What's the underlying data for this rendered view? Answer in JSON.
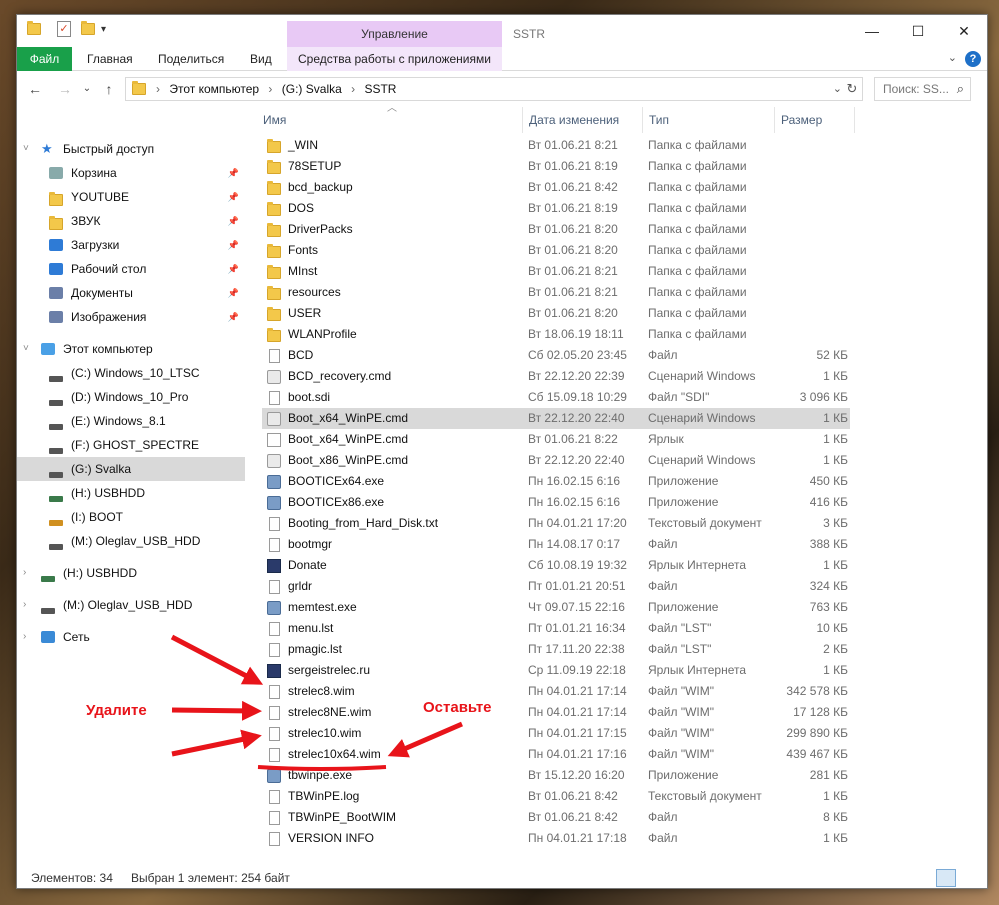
{
  "titlebar": {
    "manage_tab": "Управление",
    "window_title": "SSTR",
    "minimize": "—",
    "maximize": "☐",
    "close": "✕"
  },
  "ribbon": {
    "tabs": [
      "Файл",
      "Главная",
      "Поделиться",
      "Вид",
      "Средства работы с приложениями"
    ],
    "collapse": "⌄",
    "help": "?"
  },
  "address": {
    "back": "←",
    "forward": "→",
    "recent": "⌄",
    "up": "↑",
    "breadcrumbs": [
      "Этот компьютер",
      "(G:) Svalka",
      "SSTR"
    ],
    "refresh": "↻",
    "search_placeholder": "Поиск: SS..."
  },
  "nav": {
    "items": [
      {
        "label": "Быстрый доступ",
        "icon": "star-icon",
        "indent": 0,
        "expanded": true
      },
      {
        "label": "Корзина",
        "icon": "recycle-bin-icon",
        "indent": 1,
        "pinned": true
      },
      {
        "label": "YOUTUBE",
        "icon": "folder-icon",
        "indent": 1,
        "pinned": true
      },
      {
        "label": "ЗВУК",
        "icon": "folder-icon",
        "indent": 1,
        "pinned": true
      },
      {
        "label": "Загрузки",
        "icon": "download-icon",
        "indent": 1,
        "pinned": true
      },
      {
        "label": "Рабочий стол",
        "icon": "desktop-icon",
        "indent": 1,
        "pinned": true
      },
      {
        "label": "Документы",
        "icon": "documents-icon",
        "indent": 1,
        "pinned": true
      },
      {
        "label": "Изображения",
        "icon": "pictures-icon",
        "indent": 1,
        "pinned": true
      },
      {
        "label": "Этот компьютер",
        "icon": "computer-icon",
        "indent": 0,
        "expanded": true
      },
      {
        "label": "(C:) Windows_10_LTSC",
        "icon": "drive-icon",
        "indent": 1
      },
      {
        "label": "(D:) Windows_10_Pro",
        "icon": "drive-icon",
        "indent": 1
      },
      {
        "label": "(E:) Windows_8.1",
        "icon": "drive-icon",
        "indent": 1
      },
      {
        "label": "(F:) GHOST_SPECTRE",
        "icon": "drive-icon",
        "indent": 1
      },
      {
        "label": "(G:) Svalka",
        "icon": "drive-icon",
        "indent": 1,
        "selected": true
      },
      {
        "label": "(H:) USBHDD",
        "icon": "usb-drive-icon",
        "indent": 1
      },
      {
        "label": "(I:) BOOT",
        "icon": "boot-drive-icon",
        "indent": 1
      },
      {
        "label": "(M:) Oleglav_USB_HDD",
        "icon": "drive-icon",
        "indent": 1
      },
      {
        "label": "(H:) USBHDD",
        "icon": "usb-drive-icon",
        "indent": 0
      },
      {
        "label": "(M:) Oleglav_USB_HDD",
        "icon": "drive-icon",
        "indent": 0
      },
      {
        "label": "Сеть",
        "icon": "network-icon",
        "indent": 0
      }
    ]
  },
  "columns": {
    "name": "Имя",
    "date": "Дата изменения",
    "type": "Тип",
    "size": "Размер"
  },
  "files": [
    {
      "name": "_WIN",
      "date": "Вт 01.06.21 8:21",
      "type": "Папка с файлами",
      "size": "",
      "kind": "folder"
    },
    {
      "name": "78SETUP",
      "date": "Вт 01.06.21 8:19",
      "type": "Папка с файлами",
      "size": "",
      "kind": "folder"
    },
    {
      "name": "bcd_backup",
      "date": "Вт 01.06.21 8:42",
      "type": "Папка с файлами",
      "size": "",
      "kind": "folder"
    },
    {
      "name": "DOS",
      "date": "Вт 01.06.21 8:19",
      "type": "Папка с файлами",
      "size": "",
      "kind": "folder"
    },
    {
      "name": "DriverPacks",
      "date": "Вт 01.06.21 8:20",
      "type": "Папка с файлами",
      "size": "",
      "kind": "folder"
    },
    {
      "name": "Fonts",
      "date": "Вт 01.06.21 8:20",
      "type": "Папка с файлами",
      "size": "",
      "kind": "folder"
    },
    {
      "name": "MInst",
      "date": "Вт 01.06.21 8:21",
      "type": "Папка с файлами",
      "size": "",
      "kind": "folder"
    },
    {
      "name": "resources",
      "date": "Вт 01.06.21 8:21",
      "type": "Папка с файлами",
      "size": "",
      "kind": "folder"
    },
    {
      "name": "USER",
      "date": "Вт 01.06.21 8:20",
      "type": "Папка с файлами",
      "size": "",
      "kind": "folder"
    },
    {
      "name": "WLANProfile",
      "date": "Вт 18.06.19 18:11",
      "type": "Папка с файлами",
      "size": "",
      "kind": "folder"
    },
    {
      "name": "BCD",
      "date": "Сб 02.05.20 23:45",
      "type": "Файл",
      "size": "52 КБ",
      "kind": "file"
    },
    {
      "name": "BCD_recovery.cmd",
      "date": "Вт 22.12.20 22:39",
      "type": "Сценарий Windows",
      "size": "1 КБ",
      "kind": "cmd"
    },
    {
      "name": "boot.sdi",
      "date": "Сб 15.09.18 10:29",
      "type": "Файл \"SDI\"",
      "size": "3 096 КБ",
      "kind": "file"
    },
    {
      "name": "Boot_x64_WinPE.cmd",
      "date": "Вт 22.12.20 22:40",
      "type": "Сценарий Windows",
      "size": "1 КБ",
      "kind": "cmd",
      "selected": true
    },
    {
      "name": "Boot_x64_WinPE.cmd",
      "date": "Вт 01.06.21 8:22",
      "type": "Ярлык",
      "size": "1 КБ",
      "kind": "lnk"
    },
    {
      "name": "Boot_x86_WinPE.cmd",
      "date": "Вт 22.12.20 22:40",
      "type": "Сценарий Windows",
      "size": "1 КБ",
      "kind": "cmd"
    },
    {
      "name": "BOOTICEx64.exe",
      "date": "Пн 16.02.15 6:16",
      "type": "Приложение",
      "size": "450 КБ",
      "kind": "exe"
    },
    {
      "name": "BOOTICEx86.exe",
      "date": "Пн 16.02.15 6:16",
      "type": "Приложение",
      "size": "416 КБ",
      "kind": "exe"
    },
    {
      "name": "Booting_from_Hard_Disk.txt",
      "date": "Пн 04.01.21 17:20",
      "type": "Текстовый документ",
      "size": "3 КБ",
      "kind": "file"
    },
    {
      "name": "bootmgr",
      "date": "Пн 14.08.17 0:17",
      "type": "Файл",
      "size": "388 КБ",
      "kind": "file"
    },
    {
      "name": "Donate",
      "date": "Сб 10.08.19 19:32",
      "type": "Ярлык Интернета",
      "size": "1 КБ",
      "kind": "url"
    },
    {
      "name": "grldr",
      "date": "Пт 01.01.21 20:51",
      "type": "Файл",
      "size": "324 КБ",
      "kind": "file"
    },
    {
      "name": "memtest.exe",
      "date": "Чт 09.07.15 22:16",
      "type": "Приложение",
      "size": "763 КБ",
      "kind": "exe"
    },
    {
      "name": "menu.lst",
      "date": "Пт 01.01.21 16:34",
      "type": "Файл \"LST\"",
      "size": "10 КБ",
      "kind": "file"
    },
    {
      "name": "pmagic.lst",
      "date": "Пт 17.11.20 22:38",
      "type": "Файл \"LST\"",
      "size": "2 КБ",
      "kind": "file"
    },
    {
      "name": "sergeistrelec.ru",
      "date": "Ср 11.09.19 22:18",
      "type": "Ярлык Интернета",
      "size": "1 КБ",
      "kind": "url"
    },
    {
      "name": "strelec8.wim",
      "date": "Пн 04.01.21 17:14",
      "type": "Файл \"WIM\"",
      "size": "342 578 КБ",
      "kind": "file"
    },
    {
      "name": "strelec8NE.wim",
      "date": "Пн 04.01.21 17:14",
      "type": "Файл \"WIM\"",
      "size": "17 128 КБ",
      "kind": "file"
    },
    {
      "name": "strelec10.wim",
      "date": "Пн 04.01.21 17:15",
      "type": "Файл \"WIM\"",
      "size": "299 890 КБ",
      "kind": "file"
    },
    {
      "name": "strelec10x64.wim",
      "date": "Пн 04.01.21 17:16",
      "type": "Файл \"WIM\"",
      "size": "439 467 КБ",
      "kind": "file"
    },
    {
      "name": "tbwinpe.exe",
      "date": "Вт 15.12.20 16:20",
      "type": "Приложение",
      "size": "281 КБ",
      "kind": "exe"
    },
    {
      "name": "TBWinPE.log",
      "date": "Вт 01.06.21 8:42",
      "type": "Текстовый документ",
      "size": "1 КБ",
      "kind": "file"
    },
    {
      "name": "TBWinPE_BootWIM",
      "date": "Вт 01.06.21 8:42",
      "type": "Файл",
      "size": "8 КБ",
      "kind": "file"
    },
    {
      "name": "VERSION INFO",
      "date": "Пн 04.01.21 17:18",
      "type": "Файл",
      "size": "1 КБ",
      "kind": "file"
    }
  ],
  "status": {
    "items": "Элементов: 34",
    "selection": "Выбран 1 элемент: 254 байт"
  },
  "annotations": {
    "delete_label": "Удалите",
    "keep_label": "Оставьте",
    "color": "#e8141a"
  }
}
